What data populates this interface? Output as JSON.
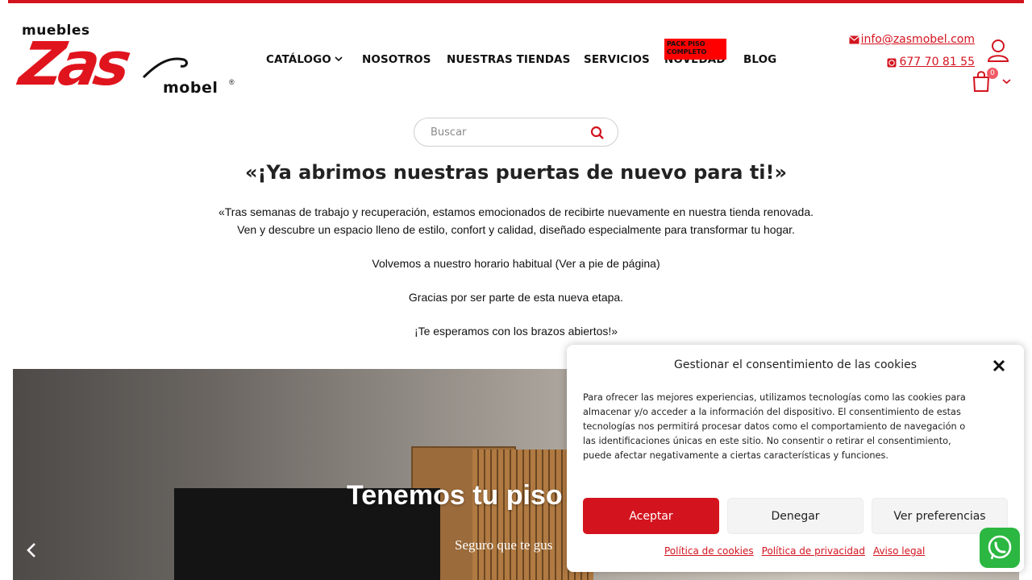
{
  "header": {
    "logo": {
      "top_text": "muebles",
      "main_text": "Zas",
      "sub_text": "mobel"
    },
    "nav": [
      {
        "label": "CATÁLOGO",
        "has_dropdown": true
      },
      {
        "label": "NOSOTROS"
      },
      {
        "label": "NUESTRAS TIENDAS"
      },
      {
        "label": "SERVICIOS"
      },
      {
        "label": "NOVEDAD"
      },
      {
        "label": "BLOG"
      }
    ],
    "nav_badge": "PACK PISO COMPLETO",
    "email": "info@zasmobel.com",
    "phone": "677 70 81 55",
    "cart_count": "0"
  },
  "search": {
    "placeholder": "Buscar"
  },
  "announcement": {
    "title": "«¡Ya abrimos nuestras puertas de nuevo para ti!»",
    "line1": "«Tras semanas de trabajo y recuperación, estamos emocionados de recibirte nuevamente en nuestra tienda renovada.",
    "line2": "Ven y descubre un espacio lleno de estilo, confort y calidad, diseñado especialmente para transformar tu hogar.",
    "line3": "Volvemos a nuestro horario habitual (Ver a pie de página)",
    "line4": "Gracias por ser parte de esta nueva etapa.",
    "line5": "¡Te esperamos con los brazos abiertos!»"
  },
  "hero": {
    "title": "Tenemos tu piso",
    "subtitle": "Seguro que te gus"
  },
  "cookie": {
    "title": "Gestionar el consentimiento de las cookies",
    "body": "Para ofrecer las mejores experiencias, utilizamos tecnologías como las cookies para almacenar y/o acceder a la información del dispositivo. El consentimiento de estas tecnologías nos permitirá procesar datos como el comportamiento de navegación o las identificaciones únicas en este sitio. No consentir o retirar el consentimiento, puede afectar negativamente a ciertas características y funciones.",
    "accept": "Aceptar",
    "deny": "Denegar",
    "preferences": "Ver preferencias",
    "links": [
      "Política de cookies",
      "Política de privacidad",
      "Aviso legal"
    ]
  },
  "colors": {
    "brand_red": "#d3141f",
    "whatsapp_green": "#2bb741"
  }
}
